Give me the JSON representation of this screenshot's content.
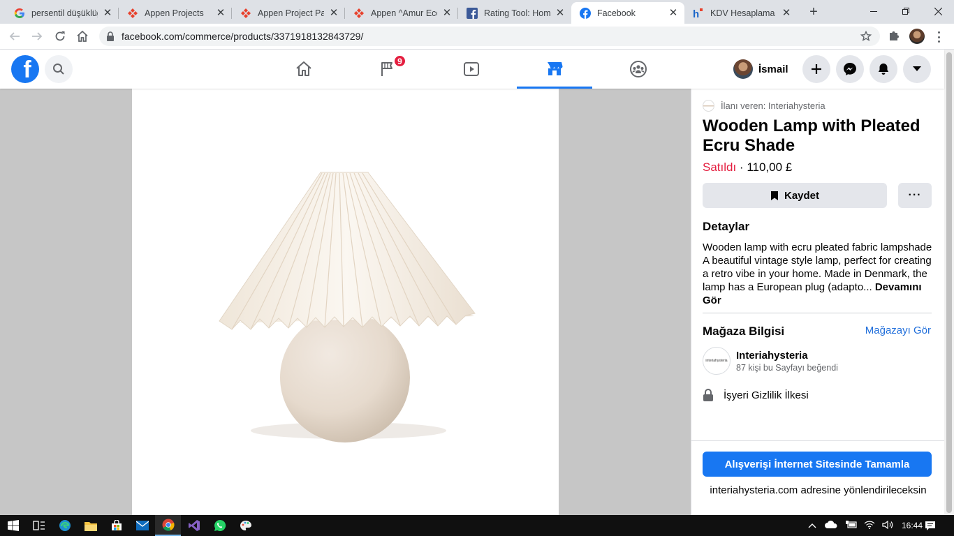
{
  "browser": {
    "tabs": [
      {
        "title": "persentil düşüklüğü",
        "icon": "google-icon"
      },
      {
        "title": "Appen Projects",
        "icon": "appen-icon"
      },
      {
        "title": "Appen Project Page",
        "icon": "appen-icon"
      },
      {
        "title": "Appen ^Amur Eco",
        "icon": "appen-icon"
      },
      {
        "title": "Rating Tool: Home",
        "icon": "facebook-square-icon"
      },
      {
        "title": "Facebook",
        "icon": "facebook-icon",
        "active": true
      },
      {
        "title": "KDV Hesaplama (K",
        "icon": "hesaplama-icon"
      }
    ],
    "url": "facebook.com/commerce/products/3371918132843729/"
  },
  "facebook": {
    "logo": "f",
    "notifications_badge": "9",
    "user_name": "İsmail",
    "active_tab": "marketplace"
  },
  "product": {
    "seller_line": "İlanı veren: Interiahysteria",
    "title": "Wooden Lamp with Pleated Ecru Shade",
    "status": "Satıldı",
    "separator": " · ",
    "price": "110,00 £",
    "save_label": "Kaydet",
    "more_label": "···",
    "details_heading": "Detaylar",
    "description": "Wooden lamp with ecru pleated fabric lampshade A beautiful vintage style lamp, perfect for creating a retro vibe in your home. Made in Denmark, the lamp has a European plug (adapto... ",
    "see_more": "Devamını Gör",
    "store_heading": "Mağaza Bilgisi",
    "store_link": "Mağazayı Gör",
    "store_name": "Interiahysteria",
    "store_logo_text": "interiahysteria",
    "store_likes": "87 kişi bu Sayfayı beğendi",
    "privacy_label": "İşyeri Gizlilik İlkesi",
    "checkout_label": "Alışverişi İnternet Sitesinde Tamamla",
    "redirect_note": "interiahysteria.com adresine yönlendirileceksin"
  },
  "taskbar": {
    "time": "16:44"
  },
  "colors": {
    "facebook_blue": "#1877f2",
    "sold_red": "#e41e3f",
    "link_blue": "#216fdb"
  }
}
